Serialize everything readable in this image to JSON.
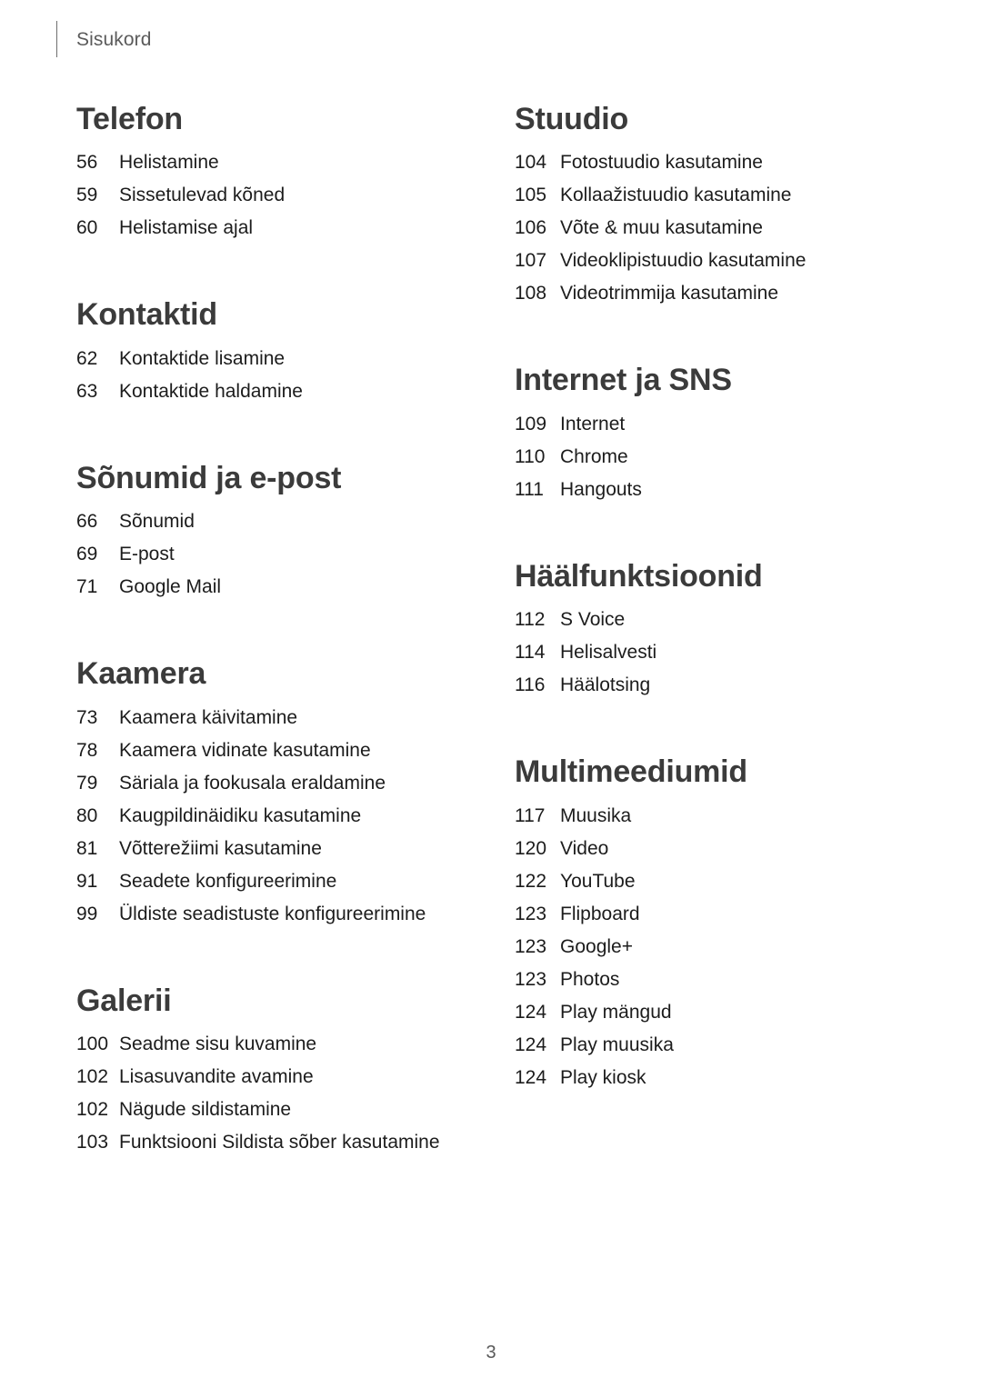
{
  "header": {
    "title": "Sisukord"
  },
  "footer": {
    "page_number": "3"
  },
  "colors": {
    "heading": "#3b3b3b",
    "body_text": "#1c1c1c",
    "header_text": "#5b5b5b",
    "rule": "#6e6e6e",
    "background": "#ffffff"
  },
  "columns": {
    "left": [
      {
        "title": "Telefon",
        "entries": [
          {
            "page": "56",
            "label": "Helistamine"
          },
          {
            "page": "59",
            "label": "Sissetulevad kõned"
          },
          {
            "page": "60",
            "label": "Helistamise ajal"
          }
        ]
      },
      {
        "title": "Kontaktid",
        "entries": [
          {
            "page": "62",
            "label": "Kontaktide lisamine"
          },
          {
            "page": "63",
            "label": "Kontaktide haldamine"
          }
        ]
      },
      {
        "title": "Sõnumid ja e-post",
        "entries": [
          {
            "page": "66",
            "label": "Sõnumid"
          },
          {
            "page": "69",
            "label": "E-post"
          },
          {
            "page": "71",
            "label": "Google Mail"
          }
        ]
      },
      {
        "title": "Kaamera",
        "entries": [
          {
            "page": "73",
            "label": "Kaamera käivitamine"
          },
          {
            "page": "78",
            "label": "Kaamera vidinate kasutamine"
          },
          {
            "page": "79",
            "label": "Säriala ja fookusala eraldamine"
          },
          {
            "page": "80",
            "label": "Kaugpildinäidiku kasutamine"
          },
          {
            "page": "81",
            "label": "Võtterežiimi kasutamine"
          },
          {
            "page": "91",
            "label": "Seadete konfigureerimine"
          },
          {
            "page": "99",
            "label": "Üldiste seadistuste konfigureerimine"
          }
        ]
      },
      {
        "title": "Galerii",
        "entries": [
          {
            "page": "100",
            "label": "Seadme sisu kuvamine"
          },
          {
            "page": "102",
            "label": "Lisasuvandite avamine"
          },
          {
            "page": "102",
            "label": "Nägude sildistamine"
          },
          {
            "page": "103",
            "label": "Funktsiooni Sildista sõber kasutamine"
          }
        ]
      }
    ],
    "right": [
      {
        "title": "Stuudio",
        "entries": [
          {
            "page": "104",
            "label": "Fotostuudio kasutamine"
          },
          {
            "page": "105",
            "label": "Kollaažistuudio kasutamine"
          },
          {
            "page": "106",
            "label": "Võte & muu kasutamine"
          },
          {
            "page": "107",
            "label": "Videoklipistuudio kasutamine"
          },
          {
            "page": "108",
            "label": "Videotrimmija kasutamine"
          }
        ]
      },
      {
        "title": "Internet ja SNS",
        "entries": [
          {
            "page": "109",
            "label": "Internet"
          },
          {
            "page": "110",
            "label": "Chrome"
          },
          {
            "page": "111",
            "label": "Hangouts"
          }
        ]
      },
      {
        "title": "Häälfunktsioonid",
        "entries": [
          {
            "page": "112",
            "label": "S Voice"
          },
          {
            "page": "114",
            "label": "Helisalvesti"
          },
          {
            "page": "116",
            "label": "Häälotsing"
          }
        ]
      },
      {
        "title": "Multimeediumid",
        "entries": [
          {
            "page": "117",
            "label": "Muusika"
          },
          {
            "page": "120",
            "label": "Video"
          },
          {
            "page": "122",
            "label": "YouTube"
          },
          {
            "page": "123",
            "label": "Flipboard"
          },
          {
            "page": "123",
            "label": "Google+"
          },
          {
            "page": "123",
            "label": "Photos"
          },
          {
            "page": "124",
            "label": "Play mängud"
          },
          {
            "page": "124",
            "label": "Play muusika"
          },
          {
            "page": "124",
            "label": "Play kiosk"
          }
        ]
      }
    ]
  }
}
